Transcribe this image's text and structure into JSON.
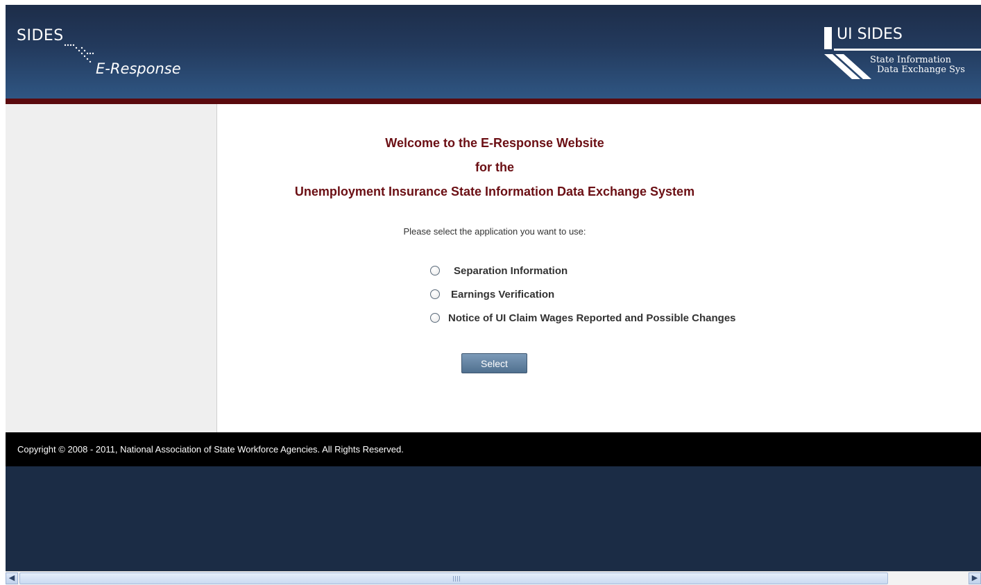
{
  "header": {
    "logo_left_top": "SIDES",
    "logo_left_bottom": "E-Response",
    "logo_right_title": "UI SIDES",
    "logo_right_line1": "State Information",
    "logo_right_line2": "Data Exchange Sys"
  },
  "welcome": {
    "line1": "Welcome to the E-Response Website",
    "line2": "for the",
    "line3": "Unemployment Insurance State Information Data Exchange System"
  },
  "prompt": "Please select the application you want to use:",
  "options": [
    {
      "label": "Separation Information",
      "selected": false
    },
    {
      "label": "Earnings Verification",
      "selected": false
    },
    {
      "label": "Notice of UI Claim Wages Reported and Possible Changes",
      "selected": false
    }
  ],
  "select_button": "Select",
  "footer": {
    "copyright": "Copyright © 2008 - 2011, National Association of State Workforce Agencies. All Rights Reserved."
  },
  "colors": {
    "header_top": "#1d2d49",
    "header_bottom": "#2f5683",
    "accent_rule": "#5a0a0e",
    "title_text": "#6b0f14",
    "footer_bg": "#000000",
    "page_bg": "#1b2c45"
  },
  "icons": {
    "scroll_left": "chevron-left-icon",
    "scroll_right": "chevron-right-icon"
  }
}
